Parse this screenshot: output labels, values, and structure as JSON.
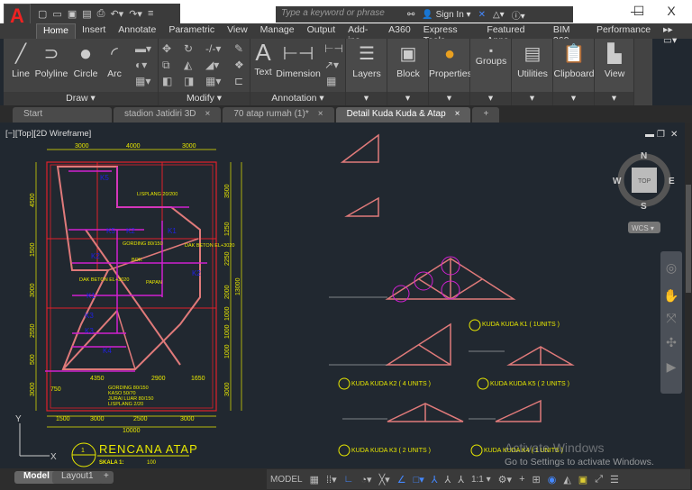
{
  "title_bar": {
    "search_placeholder": "Type a keyword or phrase",
    "sign_in": "Sign In",
    "window_minimize": "—",
    "window_maximize": "☐",
    "window_close": "X"
  },
  "ribbon_tabs": [
    "Home",
    "Insert",
    "Annotate",
    "Parametric",
    "View",
    "Manage",
    "Output",
    "Add-ins",
    "A360",
    "Express Tools",
    "Featured Apps",
    "BIM 360",
    "Performance"
  ],
  "active_ribbon_tab": "Home",
  "panels": {
    "draw": {
      "label": "Draw ▾",
      "tools": [
        "Line",
        "Polyline",
        "Circle",
        "Arc"
      ]
    },
    "modify": {
      "label": "Modify ▾"
    },
    "annotation": {
      "label": "Annotation ▾",
      "tools": [
        "Text",
        "Dimension"
      ]
    },
    "big": [
      "Layers",
      "Block",
      "Properties",
      "Groups",
      "Utilities",
      "Clipboard",
      "View"
    ]
  },
  "doc_tabs": [
    {
      "label": "Start"
    },
    {
      "label": "stadion Jatidiri 3D"
    },
    {
      "label": "70 atap rumah (1)*"
    },
    {
      "label": "Detail Kuda Kuda & Atap"
    }
  ],
  "active_doc_tab": "Detail Kuda Kuda & Atap",
  "viewport_label": "[−][Top][2D Wireframe]",
  "viewcube": {
    "top": "TOP",
    "n": "N",
    "s": "S",
    "e": "E",
    "w": "W",
    "wcs": "WCS ▾"
  },
  "drawing": {
    "plan_title": "RENCANA ATAP",
    "plan_scale": "SKALA 1:",
    "plan_scale_value": "100",
    "plan_num": "1",
    "dims_top": [
      "3000",
      "4000",
      "3000"
    ],
    "dims_bottom": [
      "1500",
      "3000",
      "2500",
      "3000"
    ],
    "dim_total": "10000",
    "dims_mid": [
      "4350",
      "2900",
      "1650",
      "750"
    ],
    "dims_left": [
      "4500",
      "1500",
      "3000",
      "2550",
      "500",
      "3000"
    ],
    "dims_right": [
      "3500",
      "1250",
      "2250",
      "2000",
      "1000",
      "1000",
      "1000",
      "3000"
    ],
    "dim_right_total": "13000",
    "plan_labels": [
      "LISPLANG 20/200",
      "GORDING 80/150",
      "BOK",
      "PAPAN",
      "DAK BETON EL+3020",
      "DAK BETON EL+3020",
      "K5",
      "K5",
      "K2",
      "K1",
      "K2",
      "K2",
      "K1",
      "K3",
      "K3",
      "K4"
    ],
    "plan_notes": [
      "GORDING 80/150",
      "KASO 50/70",
      "JURAI LUAR 80/150",
      "LISPLANG 2/20"
    ],
    "truss_titles": [
      "KUDA KUDA K1 ( 1UNITS )",
      "KUDA KUDA K2 ( 4 UNITS )",
      "KUDA KUDA K5 ( 2 UNITS )",
      "KUDA KUDA K3 ( 2 UNITS )",
      "KUDA KUDA K4 ( 1 UNITS )"
    ]
  },
  "layout_tabs": [
    "Model",
    "Layout1",
    "+"
  ],
  "status": {
    "model": "MODEL",
    "scale": "1:1 ▾"
  },
  "watermark": {
    "line1": "Activate Windows",
    "line2": "Go to Settings to activate Windows."
  },
  "colors": {
    "background": "#212830",
    "plan_red": "#e0202a",
    "truss_pink": "#e07a7a",
    "magenta": "#d020d0",
    "dim_yellow": "#e8e800",
    "label_blue": "#2020e0"
  }
}
